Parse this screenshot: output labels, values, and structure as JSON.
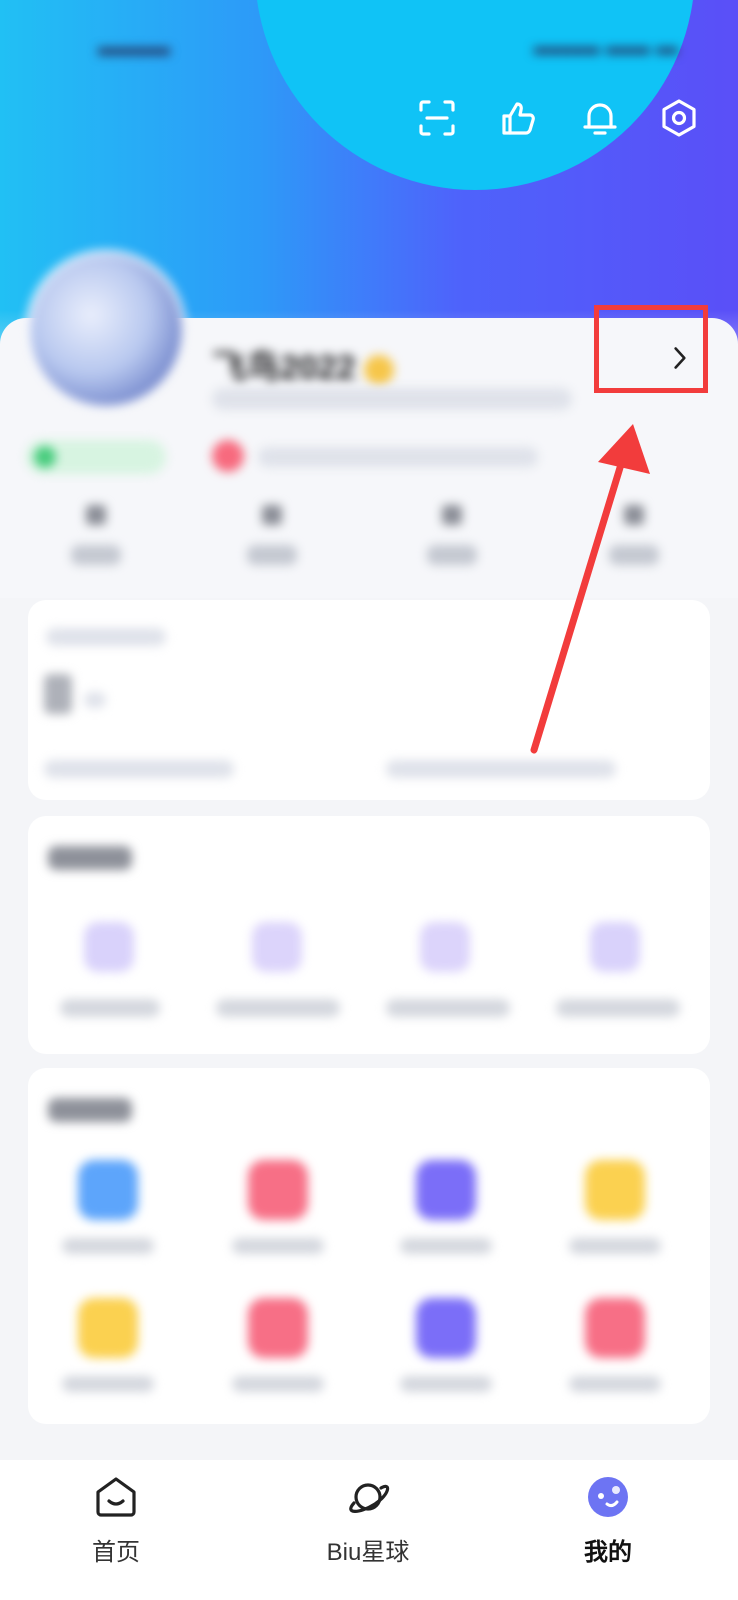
{
  "header": {
    "colors": {
      "gradient_left": "#21c0f4",
      "gradient_right": "#5a4ff8",
      "blob": "#10c3f6"
    },
    "icons": [
      "scan-icon",
      "thumbs-up-icon",
      "bell-icon",
      "settings-icon"
    ]
  },
  "profile": {
    "username": "飞鸟2022"
  },
  "annotation": {
    "color": "#f23c3c"
  },
  "nav": {
    "items": [
      {
        "label": "首页",
        "icon": "home-icon"
      },
      {
        "label": "Biu星球",
        "icon": "planet-icon"
      },
      {
        "label": "我的",
        "icon": "mine-icon",
        "active": true
      }
    ]
  }
}
